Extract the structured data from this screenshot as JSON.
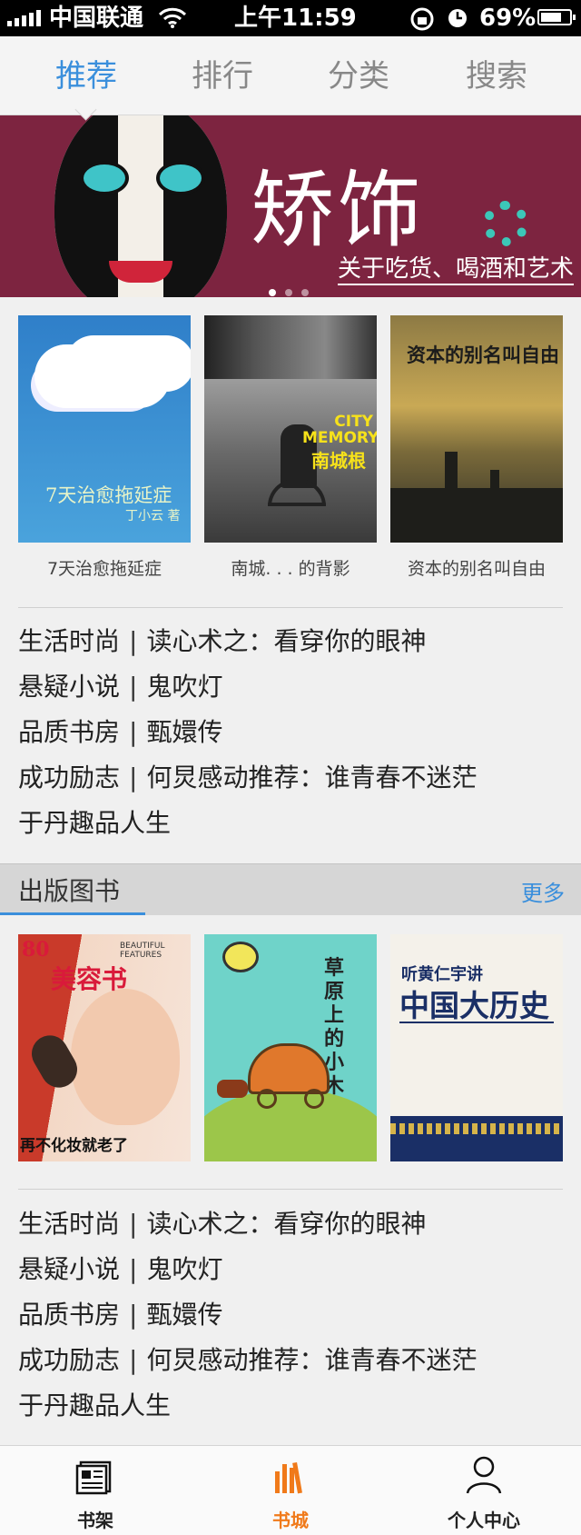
{
  "status_bar": {
    "carrier": "中国联通",
    "time": "上午11:59",
    "battery": "69%"
  },
  "tabs": [
    {
      "label": "推荐",
      "active": true
    },
    {
      "label": "排行",
      "active": false
    },
    {
      "label": "分类",
      "active": false
    },
    {
      "label": "搜索",
      "active": false
    }
  ],
  "banner": {
    "title": "矫饰",
    "subtitle": "关于吃货、喝酒和艺术",
    "pages": 3,
    "current_page": 1
  },
  "recommend": {
    "books": [
      {
        "caption": "7天治愈拖延症",
        "cover_text": "7天治愈拖延症",
        "cover_author": "丁小云 著"
      },
      {
        "caption": "南城. . . 的背影",
        "cover_text_en": "CITY MEMORY",
        "cover_text": "南城根"
      },
      {
        "caption": "资本的别名叫自由",
        "cover_text": "资本的别名叫自由"
      }
    ],
    "list": [
      {
        "category": "生活时尚",
        "title": "读心术之：看穿你的眼神"
      },
      {
        "category": "悬疑小说",
        "title": "鬼吹灯"
      },
      {
        "category": "品质书房",
        "title": "甄嬛传"
      },
      {
        "category": "成功励志",
        "title": "何炅感动推荐：谁青春不迷茫"
      },
      {
        "category": "",
        "title": "于丹趣品人生"
      }
    ]
  },
  "published": {
    "section_title": "出版图书",
    "more_label": "更多",
    "books": [
      {
        "cover_text": "美容书",
        "cover_sub": "再不化妆就老了",
        "cover_top": "BEAUTIFUL FEATURES"
      },
      {
        "cover_text": "草原上的小木屋"
      },
      {
        "cover_text": "中国大历史",
        "cover_top": "听黄仁宇讲"
      }
    ],
    "list": [
      {
        "category": "生活时尚",
        "title": "读心术之：看穿你的眼神"
      },
      {
        "category": "悬疑小说",
        "title": "鬼吹灯"
      },
      {
        "category": "品质书房",
        "title": "甄嬛传"
      },
      {
        "category": "成功励志",
        "title": "何炅感动推荐：谁青春不迷茫"
      },
      {
        "category": "",
        "title": "于丹趣品人生"
      }
    ]
  },
  "bottom_nav": [
    {
      "label": "书架",
      "icon": "bookshelf-icon",
      "active": false
    },
    {
      "label": "书城",
      "icon": "bookstore-icon",
      "active": true
    },
    {
      "label": "个人中心",
      "icon": "user-icon",
      "active": false
    }
  ],
  "colors": {
    "accent": "#3a8fdc",
    "active_nav": "#f07a1a",
    "banner_bg": "#7d2440"
  }
}
